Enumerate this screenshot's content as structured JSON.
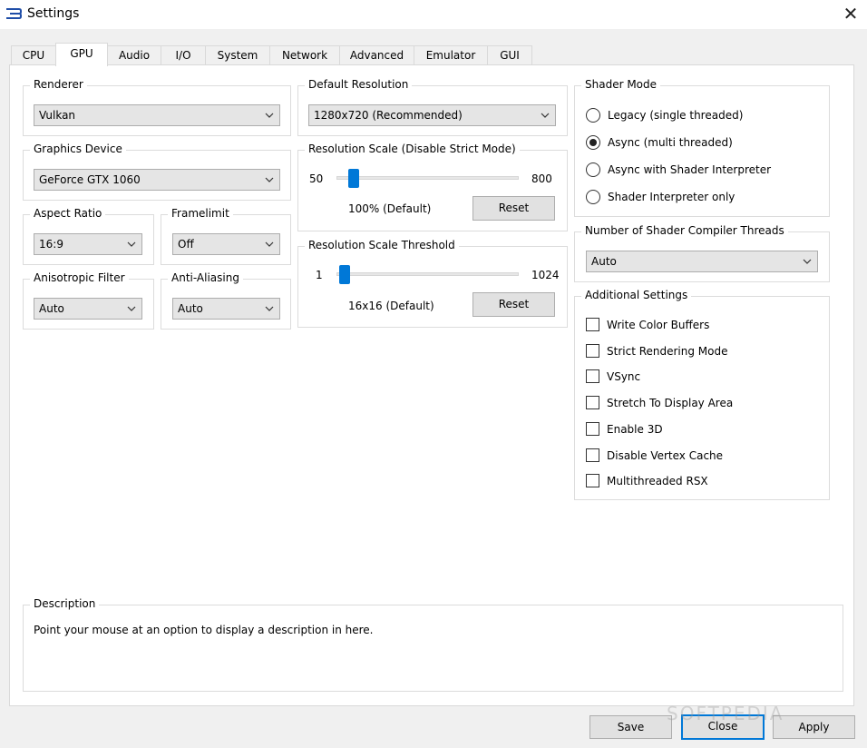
{
  "window": {
    "title": "Settings"
  },
  "tabs": [
    {
      "label": "CPU"
    },
    {
      "label": "GPU"
    },
    {
      "label": "Audio"
    },
    {
      "label": "I/O"
    },
    {
      "label": "System"
    },
    {
      "label": "Network"
    },
    {
      "label": "Advanced"
    },
    {
      "label": "Emulator"
    },
    {
      "label": "GUI"
    }
  ],
  "active_tab": "GPU",
  "renderer": {
    "title": "Renderer",
    "value": "Vulkan"
  },
  "graphics_device": {
    "title": "Graphics Device",
    "value": "GeForce GTX 1060"
  },
  "aspect_ratio": {
    "title": "Aspect Ratio",
    "value": "16:9"
  },
  "framelimit": {
    "title": "Framelimit",
    "value": "Off"
  },
  "anisotropic_filter": {
    "title": "Anisotropic Filter",
    "value": "Auto"
  },
  "anti_aliasing": {
    "title": "Anti-Aliasing",
    "value": "Auto"
  },
  "default_resolution": {
    "title": "Default Resolution",
    "value": "1280x720 (Recommended)"
  },
  "resolution_scale": {
    "title": "Resolution Scale (Disable Strict Mode)",
    "min_label": "50",
    "max_label": "800",
    "min": 50,
    "max": 800,
    "value": 100,
    "value_label": "100% (Default)",
    "reset_label": "Reset"
  },
  "resolution_threshold": {
    "title": "Resolution Scale Threshold",
    "min_label": "1",
    "max_label": "1024",
    "min": 1,
    "max": 1024,
    "value": 16,
    "value_label": "16x16 (Default)",
    "reset_label": "Reset"
  },
  "shader_mode": {
    "title": "Shader Mode",
    "options": [
      {
        "label": "Legacy (single threaded)",
        "selected": false
      },
      {
        "label": "Async (multi threaded)",
        "selected": true
      },
      {
        "label": "Async with Shader Interpreter",
        "selected": false
      },
      {
        "label": "Shader Interpreter only",
        "selected": false
      }
    ]
  },
  "shader_threads": {
    "title": "Number of Shader Compiler Threads",
    "value": "Auto"
  },
  "additional": {
    "title": "Additional Settings",
    "items": [
      {
        "label": "Write Color Buffers",
        "checked": false
      },
      {
        "label": "Strict Rendering Mode",
        "checked": false
      },
      {
        "label": "VSync",
        "checked": false
      },
      {
        "label": "Stretch To Display Area",
        "checked": false
      },
      {
        "label": "Enable 3D",
        "checked": false
      },
      {
        "label": "Disable Vertex Cache",
        "checked": false
      },
      {
        "label": "Multithreaded RSX",
        "checked": false
      }
    ]
  },
  "description": {
    "title": "Description",
    "text": "Point your mouse at an option to display a description in here."
  },
  "buttons": {
    "save": "Save",
    "close": "Close",
    "apply": "Apply"
  },
  "watermark": "SOFTPEDIA",
  "colors": {
    "accent": "#0078d7",
    "panel": "#ffffff",
    "window": "#f0f0f0"
  }
}
